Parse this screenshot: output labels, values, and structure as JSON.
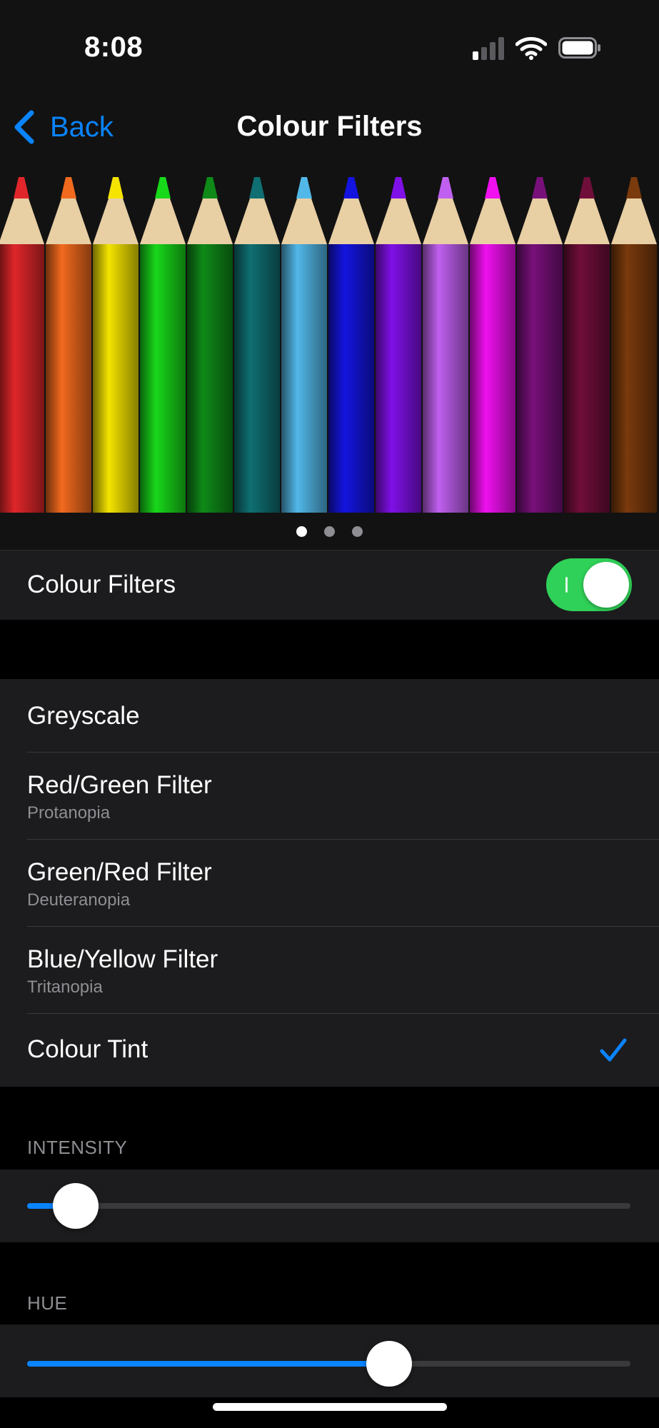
{
  "status_bar": {
    "time": "8:08",
    "signal_icon": "cellular-signal-icon",
    "wifi_icon": "wifi-icon",
    "battery_icon": "battery-icon"
  },
  "nav": {
    "back_label": "Back",
    "back_icon": "chevron-left-icon",
    "title": "Colour Filters"
  },
  "banner": {
    "pencil_colors": [
      "#e0262a",
      "#f26a1e",
      "#f4e400",
      "#18d81a",
      "#0f8a18",
      "#0f6f72",
      "#52b8e8",
      "#1414e0",
      "#8010e8",
      "#c060f0",
      "#f010f0",
      "#78107a",
      "#700e3a",
      "#7a3a0c"
    ],
    "pages": 3,
    "active_page": 0
  },
  "colour_filters_row": {
    "label": "Colour Filters",
    "enabled": true
  },
  "filters": [
    {
      "label": "Greyscale",
      "sublabel": "",
      "selected": false
    },
    {
      "label": "Red/Green Filter",
      "sublabel": "Protanopia",
      "selected": false
    },
    {
      "label": "Green/Red Filter",
      "sublabel": "Deuteranopia",
      "selected": false
    },
    {
      "label": "Blue/Yellow Filter",
      "sublabel": "Tritanopia",
      "selected": false
    },
    {
      "label": "Colour Tint",
      "sublabel": "",
      "selected": true
    }
  ],
  "intensity": {
    "header": "INTENSITY",
    "value": 0.08
  },
  "hue": {
    "header": "HUE",
    "value": 0.6
  },
  "colors": {
    "accent": "#0a84ff",
    "toggle_on": "#30d158"
  }
}
